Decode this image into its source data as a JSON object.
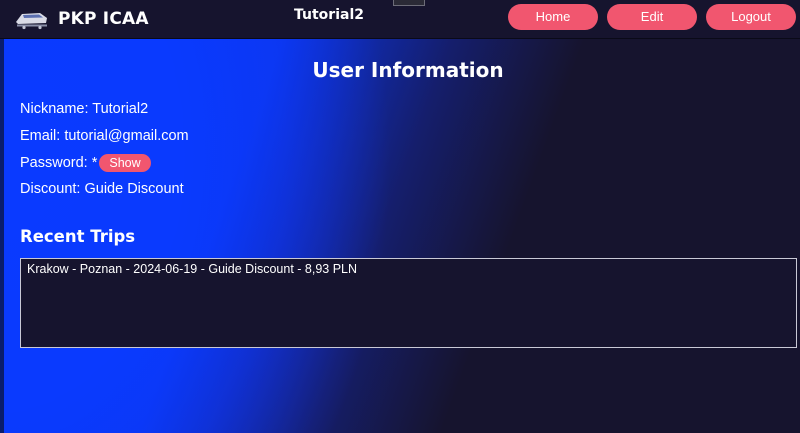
{
  "brand": {
    "name": "PKP ICAA",
    "logo_icon": "train-icon"
  },
  "header": {
    "username": "Tutorial2"
  },
  "nav": {
    "home": "Home",
    "edit": "Edit",
    "logout": "Logout"
  },
  "user_info": {
    "title": "User Information",
    "nickname": "Nickname: Tutorial2",
    "email": "Email: tutorial@gmail.com",
    "password_label": "Password: *",
    "show_button": "Show",
    "discount": "Discount: Guide Discount"
  },
  "recent_trips": {
    "title": "Recent Trips",
    "items": [
      "Krakow - Poznan - 2024-06-19 - Guide Discount - 8,93 PLN"
    ]
  },
  "colors": {
    "accent": "#f1566f",
    "background": "#16142e",
    "gradient": "#0a3aff"
  }
}
